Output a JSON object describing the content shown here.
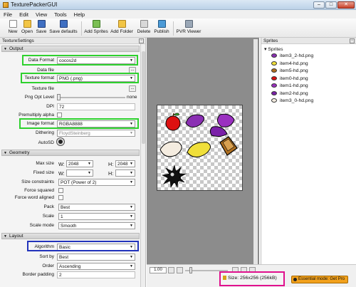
{
  "window": {
    "title": "TexturePackerGUI"
  },
  "menu": [
    "File",
    "Edit",
    "View",
    "Tools",
    "Help"
  ],
  "toolbar": {
    "new": "New",
    "open": "Open",
    "save": "Save",
    "save_defaults": "Save defaults",
    "add_sprites": "Add Sprites",
    "add_folder": "Add Folder",
    "delete": "Delete",
    "publish": "Publish",
    "pvr_viewer": "PVR Viewer"
  },
  "texture_settings": {
    "panel_title": "TextureSettings",
    "output": {
      "section": "Output",
      "data_format_label": "Data Format",
      "data_format": "cocos2d",
      "data_file_label": "Data file",
      "texture_format_label": "Texture format",
      "texture_format": "PNG (.png)",
      "texture_file_label": "Texture file",
      "png_opt_label": "Png Opt Level",
      "png_opt_value": "none",
      "dpi_label": "DPI",
      "dpi": "72",
      "premultiply_label": "Premultiply alpha",
      "image_format_label": "Image format",
      "image_format": "RGBA8888",
      "dithering_label": "Dithering",
      "dithering": "FloydSteinberg",
      "autosd_label": "AutoSD"
    },
    "geometry": {
      "section": "Geometry",
      "max_size_label": "Max size",
      "w_label": "W:",
      "max_w": "2048",
      "h_label": "H:",
      "max_h": "2048",
      "fixed_size_label": "Fixed size",
      "size_constraints_label": "Size constraints",
      "size_constraints": "POT (Power of 2)",
      "force_squared_label": "Force squared",
      "force_word_label": "Force word aligned",
      "pack_label": "Pack",
      "pack": "Best",
      "scale_label": "Scale",
      "scale": "1",
      "scale_mode_label": "Scale mode",
      "scale_mode": "Smooth"
    },
    "layout": {
      "section": "Layout",
      "algorithm_label": "Algorithm",
      "algorithm": "Basic",
      "sort_by_label": "Sort by",
      "sort_by": "Best",
      "order_label": "Order",
      "order": "Ascending",
      "border_padding_label": "Border padding",
      "border_padding": "2"
    }
  },
  "sprites_panel": {
    "title": "Sprites",
    "root": "Sprites",
    "items": [
      {
        "name": "item3_2-hd.png",
        "color": "#8a2fb3"
      },
      {
        "name": "item4-hd.png",
        "color": "#f0df3a"
      },
      {
        "name": "item5-hd.png",
        "color": "#b07020"
      },
      {
        "name": "item0-hd.png",
        "color": "#dd1111"
      },
      {
        "name": "item1-hd.png",
        "color": "#9a30c0"
      },
      {
        "name": "item2-hd.png",
        "color": "#7a20a8"
      },
      {
        "name": "item3_0-hd.png",
        "color": "#f4ece0"
      }
    ]
  },
  "status": {
    "zoom": "1.00",
    "size": "Size: 256x256 (256kB)",
    "essential_mode": "Essential mode: Get Pro"
  },
  "colors": {
    "highlight_green": "#2ed12e",
    "highlight_blue": "#2233bb",
    "highlight_pink": "#e0108d",
    "pro_button": "#f2a11c"
  }
}
